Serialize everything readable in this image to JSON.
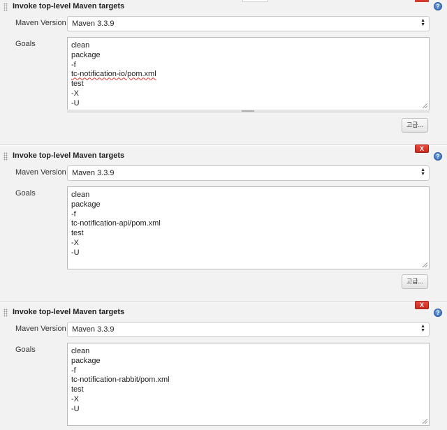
{
  "steps": [
    {
      "title": "Invoke top-level Maven targets",
      "maven_version_label": "Maven Version",
      "maven_version": "Maven 3.3.9",
      "goals_label": "Goals",
      "goals": [
        "clean",
        "package",
        "-f",
        "tc-notification-io/pom.xml",
        "test",
        "-X",
        "-U"
      ],
      "advanced_label": "고급...",
      "delete_label": "X",
      "help_label": "?"
    },
    {
      "title": "Invoke top-level Maven targets",
      "maven_version_label": "Maven Version",
      "maven_version": "Maven 3.3.9",
      "goals_label": "Goals",
      "goals": [
        "clean",
        "package",
        "-f",
        "tc-notification-api/pom.xml",
        "test",
        "-X",
        "-U"
      ],
      "advanced_label": "고급...",
      "delete_label": "X",
      "help_label": "?"
    },
    {
      "title": "Invoke top-level Maven targets",
      "maven_version_label": "Maven Version",
      "maven_version": "Maven 3.3.9",
      "goals_label": "Goals",
      "goals": [
        "clean",
        "package",
        "-f",
        "tc-notification-rabbit/pom.xml",
        "test",
        "-X",
        "-U"
      ],
      "delete_label": "X",
      "help_label": "?"
    }
  ]
}
